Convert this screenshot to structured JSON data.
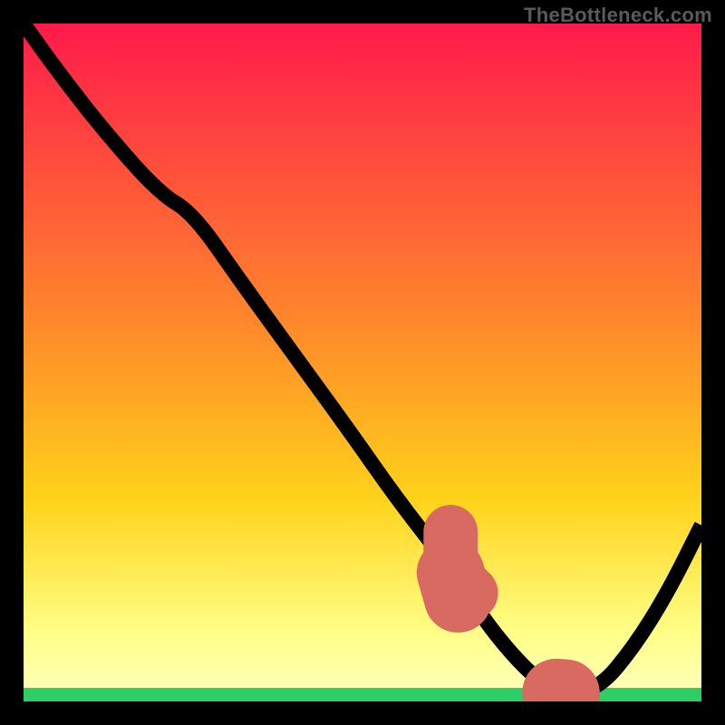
{
  "watermark": "TheBottleneck.com",
  "chart_data": {
    "type": "line",
    "title": "",
    "xlabel": "",
    "ylabel": "",
    "xlim": [
      0,
      100
    ],
    "ylim": [
      0,
      100
    ],
    "gradient": {
      "top_color": "#ff1a4b",
      "mid_color": "#ffd21a",
      "near_bottom_color": "#ffff88",
      "bottom_color": "#2ecd66"
    },
    "series": [
      {
        "name": "bottleneck-curve",
        "color": "#000000",
        "x": [
          0,
          5,
          12,
          20,
          25,
          32,
          40,
          48,
          55,
          62,
          68,
          72,
          76,
          80,
          85,
          90,
          95,
          100
        ],
        "y": [
          100,
          93,
          84,
          75,
          72,
          62,
          51,
          40,
          30,
          21,
          12,
          7,
          3,
          1,
          2,
          8,
          16,
          26
        ]
      }
    ],
    "highlight": {
      "name": "sweet-spot-dots",
      "color": "#d96a62",
      "x": [
        63,
        65,
        67.5,
        70,
        73,
        76,
        80
      ],
      "y": [
        19,
        12,
        7,
        4,
        2,
        1.5,
        1.2
      ]
    },
    "good_band_y": 2
  }
}
